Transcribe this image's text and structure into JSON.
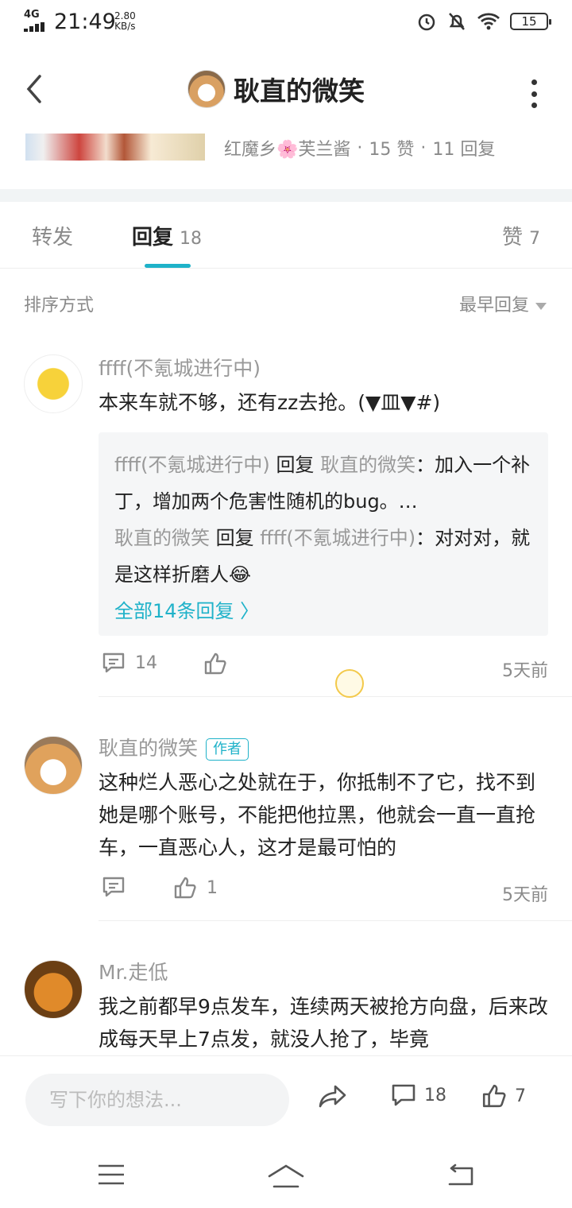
{
  "status_bar": {
    "network": "4G",
    "time": "21:49",
    "speed_value": "2.80",
    "speed_unit": "KB/s",
    "battery": "15"
  },
  "header": {
    "title": "耿直的微笑",
    "meta": {
      "users": "红魔乡🌸芙兰酱",
      "likes": "15 赞",
      "replies": "11 回复",
      "dot": "·"
    }
  },
  "tabs": [
    {
      "label": "转发",
      "count": ""
    },
    {
      "label": "回复",
      "count": "18"
    },
    {
      "label": "赞",
      "count": "7"
    }
  ],
  "sort": {
    "label": "排序方式",
    "value": "最早回复"
  },
  "comments": [
    {
      "name": "ffff(不氪城进行中)",
      "text": "本来车就不够，还有zz去抢。(▼皿▼#)",
      "sub_replies": [
        {
          "from": "ffff(不氪城进行中)",
          "verb": "回复",
          "to": "耿直的微笑",
          "text": "：加入一个补丁，增加两个危害性随机的bug。…"
        },
        {
          "from": "耿直的微笑",
          "verb": "回复",
          "to": "ffff(不氪城进行中)",
          "text": "：对对对，就是这样折磨人😂"
        }
      ],
      "all_replies": "全部14条回复 〉",
      "comment_count": "14",
      "like_count": "",
      "time": "5天前"
    },
    {
      "name": "耿直的微笑",
      "badge": "作者",
      "text": "这种烂人恶心之处就在于，你抵制不了它，找不到她是哪个账号，不能把他拉黑，他就会一直一直抢车，一直恶心人，这才是最可怕的",
      "comment_count": "",
      "like_count": "1",
      "time": "5天前"
    },
    {
      "name": "Mr.走低",
      "text": "我之前都早9点发车，连续两天被抢方向盘，后来改成每天早上7点发，就没人抢了，毕竟"
    }
  ],
  "bottom_bar": {
    "placeholder": "写下你的想法...",
    "comment_count": "18",
    "like_count": "7"
  },
  "colors": {
    "accent": "#1fb2c9",
    "grey_text": "#8a8a8a"
  }
}
